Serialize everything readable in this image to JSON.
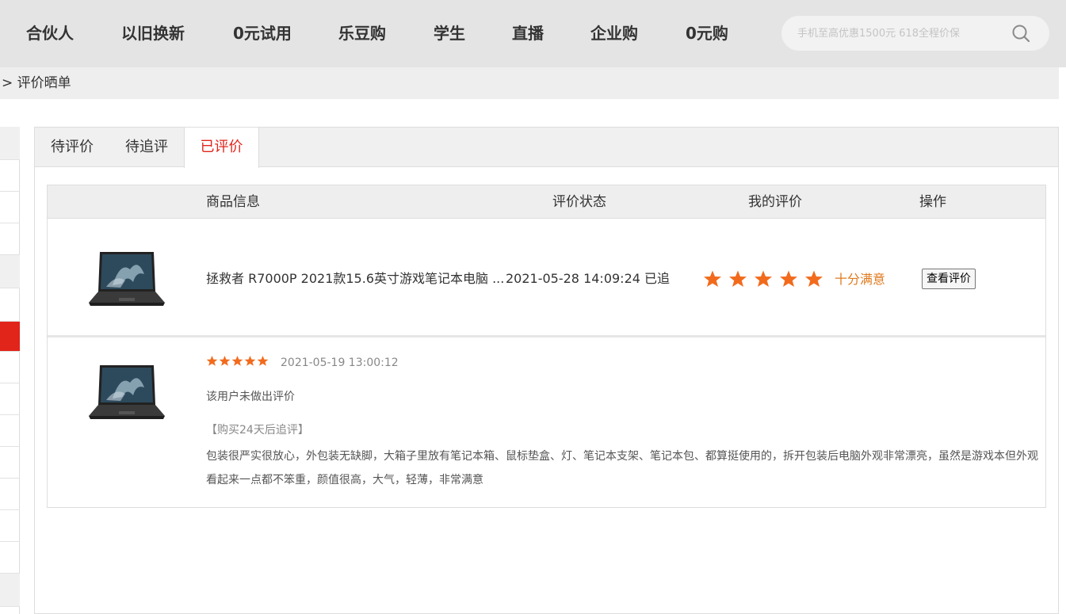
{
  "nav": {
    "items": [
      "合伙人",
      "以旧换新",
      "0元试用",
      "乐豆购",
      "学生",
      "直播",
      "企业购",
      "0元购"
    ],
    "search_placeholder": "手机至高优惠1500元 618全程价保"
  },
  "breadcrumb": "> 评价晒单",
  "tabs": [
    {
      "label": "待评价",
      "active": false
    },
    {
      "label": "待追评",
      "active": false
    },
    {
      "label": "已评价",
      "active": true
    }
  ],
  "table": {
    "headers": {
      "product": "商品信息",
      "status": "评价状态",
      "my_review": "我的评价",
      "action": "操作"
    },
    "order": {
      "product_name": "拯救者 R7000P 2021款15.6英寸游戏笔记本电脑 ...",
      "date": "2021-05-28 14:09:24",
      "status": "已追",
      "rating": 5,
      "rating_text": "十分满意",
      "view_button": "查看评价"
    },
    "review": {
      "rating": 5,
      "date": "2021-05-19 13:00:12",
      "initial_comment": "该用户未做出评价",
      "followup_tag": "【购买24天后追评】",
      "followup_text": "包装很严实很放心，外包装无缺脚，大箱子里放有笔记本箱、鼠标垫盒、灯、笔记本支架、笔记本包、都算挺使用的，拆开包装后电脑外观非常漂亮，虽然是游戏本但外观看起来一点都不笨重，颜值很高，大气，轻薄，非常满意"
    }
  },
  "colors": {
    "accent": "#e1251b",
    "star": "#f26b1d",
    "rating_text": "#e07a1f"
  }
}
